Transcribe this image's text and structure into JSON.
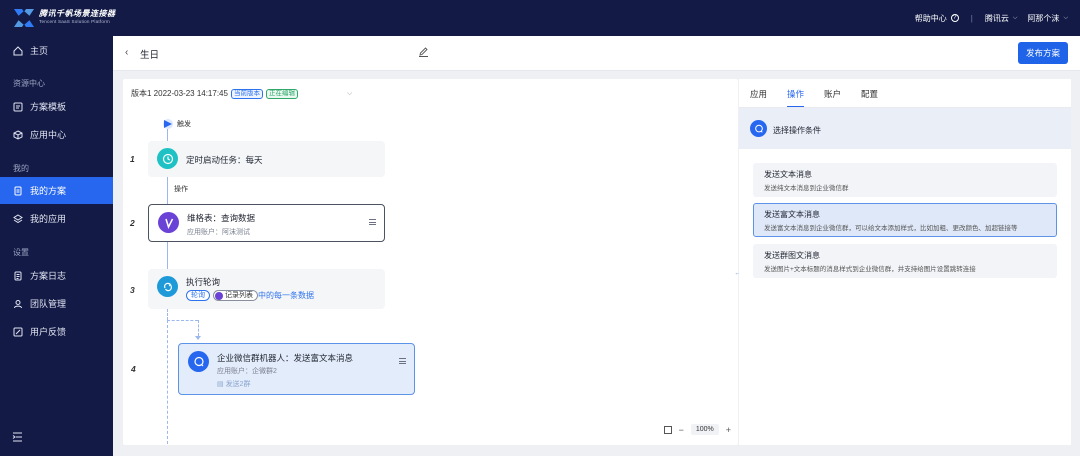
{
  "brand": {
    "name_cn": "腾讯千帆场景连接器",
    "name_en": "Tencent SaaS Solution Platform"
  },
  "topbar": {
    "help": "帮助中心",
    "cloud": "腾讯云",
    "user": "阿那个沫"
  },
  "sidebar": {
    "home": "主页",
    "section_resources": "资源中心",
    "templates": "方案模板",
    "app_center": "应用中心",
    "section_mine": "我的",
    "my_plans": "我的方案",
    "my_apps": "我的应用",
    "section_settings": "设置",
    "plan_logs": "方案日志",
    "team": "团队管理",
    "feedback": "用户反馈"
  },
  "header": {
    "title": "生日",
    "publish": "发布方案"
  },
  "canvas": {
    "version": "版本1  2022-03-23 14:17:45",
    "tag_current": "当前版本",
    "tag_editing": "正在编辑",
    "trigger_label": "触发",
    "op_label": "操作",
    "nodes": [
      {
        "num": "1",
        "title": "定时启动任务：每天"
      },
      {
        "num": "2",
        "title": "维格表：查询数据",
        "sub": "应用账户：阿沫测试"
      },
      {
        "num": "3",
        "title": "执行轮询",
        "chip1": "轮询",
        "chip2": "记录列表",
        "chip3": "中的每一条数据"
      },
      {
        "num": "4",
        "title": "企业微信群机器人：发送富文本消息",
        "sub": "应用账户：企微群2",
        "sub2": "发送2群"
      }
    ],
    "zoom": "100%"
  },
  "panel": {
    "tabs": [
      "应用",
      "操作",
      "账户",
      "配置"
    ],
    "active_tab": "操作",
    "condition": "选择操作条件",
    "options": [
      {
        "title": "发送文本消息",
        "desc": "发送纯文本消息到企业微信群"
      },
      {
        "title": "发送富文本消息",
        "desc": "发送富文本消息到企业微信群，可以给文本添加样式，比如加粗、更改颜色、加超链接等"
      },
      {
        "title": "发送群图文消息",
        "desc": "发送图片+文本标题的消息样式到企业微信群，并支持给图片设置跳转连接"
      }
    ]
  },
  "colors": {
    "accent": "#2767f0",
    "sidebar_bg": "#121a45",
    "canvas_bg": "#eef0f4"
  }
}
